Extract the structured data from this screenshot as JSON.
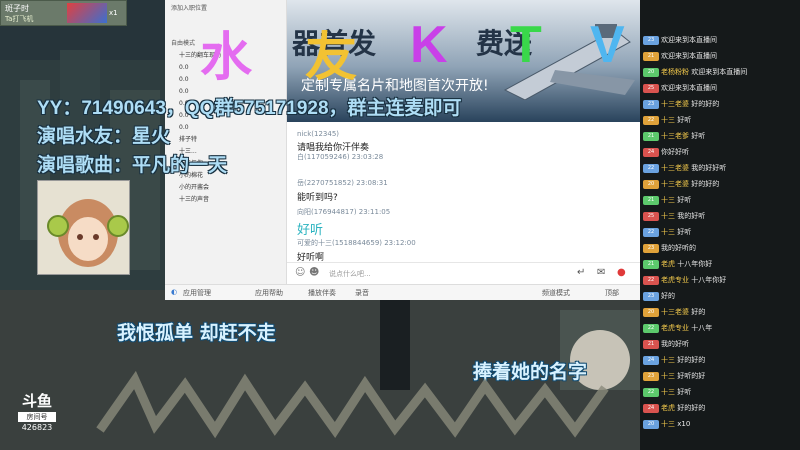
{
  "stream": {
    "top_user": "斑子时",
    "top_user_sub": "Ta打飞机",
    "top_count": "x1",
    "yy_line": "YY：71490643，QQ群575171928，群主连麦即可",
    "singer_line": "演唱水友：星火",
    "song_line": "演唱歌曲：平凡的一天",
    "ktv_letters": [
      "水",
      "友",
      "K",
      "T",
      "V"
    ],
    "ktv_colors": [
      "#e46cf0",
      "#f2c232",
      "#c940e8",
      "#39d84a",
      "#4fb6f0"
    ],
    "douyu_logo": "斗鱼",
    "douyu_label": "房间号",
    "room_number": "426823"
  },
  "banner": {
    "title": "器首发",
    "title_right": "费送",
    "subtitle": "定制专属名片和地图首次开放!"
  },
  "app": {
    "sidebar_title": "添加入职位置",
    "sidebar_mode": "自由模式",
    "sidebar_items": [
      "十三的翻车现场",
      "0.0",
      "0.0",
      "0.0",
      "0.0",
      "0.0",
      "0.0",
      "排子特",
      "十三...",
      "十三与你...",
      "小的棉花",
      "小的开酱会",
      "十三的声音"
    ],
    "messages": [
      {
        "meta": "nick(12345)",
        "text": "请唱我给你汗伴奏",
        "hl": false
      },
      {
        "meta": "白(117059246) 23:03:28",
        "text": "",
        "hl": false
      },
      {
        "meta": "岳(2270751852) 23:08:31",
        "text": "能听到吗?",
        "hl": false
      },
      {
        "meta": "向阳(176944817) 23:11:05",
        "text": "好听",
        "hl": true
      },
      {
        "meta": "可爱的十三(1518844659) 23:12:00",
        "text": "好听啊",
        "hl": false
      }
    ],
    "input_placeholder": "说点什么吧...",
    "bottom_bar": {
      "b1": "应用管理",
      "b2": "应用帮助",
      "b3": "播放伴奏",
      "b4": "录音",
      "b5": "频道模式",
      "b6": "顶部"
    }
  },
  "danmaku": [
    {
      "lvl": "23",
      "badge": "",
      "user": "",
      "text": "欢迎来到本直播间"
    },
    {
      "lvl": "21",
      "badge": "",
      "user": "",
      "text": "欢迎来到本直播间"
    },
    {
      "lvl": "20",
      "badge": "",
      "user": "老杨粉粉",
      "text": "欢迎来到本直播间"
    },
    {
      "lvl": "25",
      "badge": "",
      "user": "",
      "text": "欢迎来到本直播间"
    },
    {
      "lvl": "23",
      "badge": "",
      "user": "十三老婆",
      "text": "好的好的"
    },
    {
      "lvl": "22",
      "badge": "",
      "user": "十三",
      "text": "好听"
    },
    {
      "lvl": "21",
      "badge": "",
      "user": "十三老爹",
      "text": "好听"
    },
    {
      "lvl": "24",
      "badge": "",
      "user": "",
      "text": "你好好听"
    },
    {
      "lvl": "22",
      "badge": "",
      "user": "十三老婆",
      "text": "我的好好听"
    },
    {
      "lvl": "20",
      "badge": "",
      "user": "十三老婆",
      "text": "好的好的"
    },
    {
      "lvl": "21",
      "badge": "",
      "user": "十三",
      "text": "好听"
    },
    {
      "lvl": "25",
      "badge": "",
      "user": "十三",
      "text": "我的好听"
    },
    {
      "lvl": "22",
      "badge": "",
      "user": "十三",
      "text": "好听"
    },
    {
      "lvl": "23",
      "badge": "",
      "user": "",
      "text": "我的好听的"
    },
    {
      "lvl": "21",
      "badge": "",
      "user": "老虎",
      "text": "十八年你好"
    },
    {
      "lvl": "22",
      "badge": "",
      "user": "老虎专业",
      "text": "十八年你好"
    },
    {
      "lvl": "23",
      "badge": "",
      "user": "",
      "text": "好的"
    },
    {
      "lvl": "20",
      "badge": "",
      "user": "十三老婆",
      "text": "好的"
    },
    {
      "lvl": "22",
      "badge": "",
      "user": "老虎专业",
      "text": "十八年"
    },
    {
      "lvl": "21",
      "badge": "",
      "user": "",
      "text": "我的好听"
    },
    {
      "lvl": "24",
      "badge": "",
      "user": "十三",
      "text": "好的好的"
    },
    {
      "lvl": "23",
      "badge": "",
      "user": "十三",
      "text": "好听的好"
    },
    {
      "lvl": "22",
      "badge": "",
      "user": "十三",
      "text": "好听"
    },
    {
      "lvl": "24",
      "badge": "",
      "user": "老虎",
      "text": "好的好的"
    },
    {
      "lvl": "20",
      "badge": "",
      "user": "十三",
      "text": "x10"
    }
  ],
  "lyrics": {
    "line1": "我恨孤单 却赶不走",
    "line2": "捧着她的名字"
  },
  "colors": {
    "panel_bg": "#15191a",
    "lyric_text": "#d8f2ff",
    "overlay_text": "#aeddf5"
  }
}
